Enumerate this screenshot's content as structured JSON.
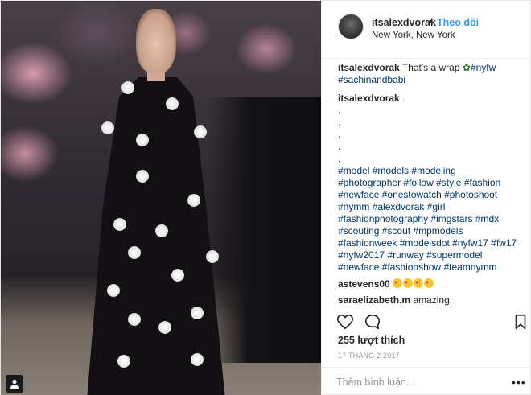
{
  "post": {
    "username": "itsalexdvorak",
    "follow_dot": "•",
    "follow_label": "Theo dõi",
    "location": "New York, New York"
  },
  "caption": {
    "username": "itsalexdvorak",
    "text": "That's a wrap",
    "tag1": "#nyfw",
    "tag2": "#sachinandbabi"
  },
  "hashtag_comment": {
    "username": "itsalexdvorak",
    "text": ".",
    "dots": [
      ".",
      ".",
      ".",
      ".",
      "."
    ],
    "lines": [
      [
        "#model",
        "#models",
        "#modeling"
      ],
      [
        "#photographer",
        "#follow",
        "#style",
        "#fashion"
      ],
      [
        "#newface",
        "#onestowatch",
        "#photoshoot"
      ],
      [
        "#nymm",
        "#alexdvorak",
        "#girl"
      ],
      [
        "#fashionphotography",
        "#imgstars",
        "#mdx"
      ],
      [
        "#scouting",
        "#scout",
        "#mpmodels"
      ],
      [
        "#fashionweek",
        "#modelsdot",
        "#nyfw17",
        "#fw17"
      ],
      [
        "#nyfw2017",
        "#runway",
        "#supermodel"
      ],
      [
        "#newface",
        "#fashionshow",
        "#teamnymm"
      ]
    ]
  },
  "comment2": {
    "username": "astevens00",
    "emoji_count": 4
  },
  "comment3": {
    "username": "saraelizabeth.m",
    "text": "amazing."
  },
  "likes": "255 lượt thích",
  "date": "17 THÁNG 2 2017",
  "comment_input": {
    "placeholder": "Thêm bình luận..."
  },
  "more_label": "•••",
  "icons": [
    "heart-icon",
    "comment-icon",
    "bookmark-icon",
    "user-tag-icon"
  ],
  "colors": {
    "link": "#3897f0",
    "hashtag": "#003569",
    "muted": "#999999",
    "text": "#262626"
  }
}
